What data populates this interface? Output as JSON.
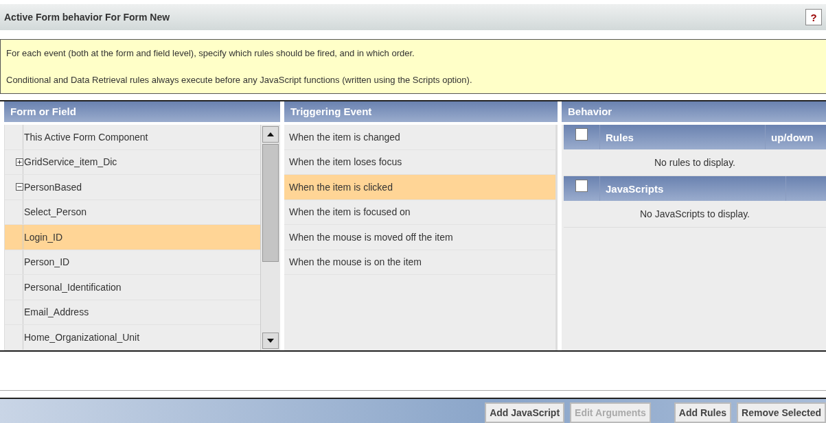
{
  "title": "Active Form behavior For Form New",
  "help": "?",
  "info": [
    "For each event (both at the form and field level), specify which rules should be fired, and in which order.",
    "Conditional and Data Retrieval rules always execute before any JavaScript functions (written using the Scripts option)."
  ],
  "form_or_field": {
    "heading": "Form or Field",
    "items": [
      {
        "label": "This Active Form Component",
        "selected": false
      },
      {
        "label": "GridService_item_Dic",
        "selected": false,
        "expanded": false
      },
      {
        "label": "PersonBased",
        "selected": false,
        "expanded": true,
        "children": [
          {
            "label": "Select_Person",
            "selected": false
          },
          {
            "label": "Login_ID",
            "selected": true
          },
          {
            "label": "Person_ID",
            "selected": false
          },
          {
            "label": "Personal_Identification",
            "selected": false
          },
          {
            "label": "Email_Address",
            "selected": false
          },
          {
            "label": "Home_Organizational_Unit",
            "selected": false
          }
        ]
      }
    ]
  },
  "triggering_event": {
    "heading": "Triggering Event",
    "items": [
      {
        "label": "When the item is changed",
        "selected": false
      },
      {
        "label": "When the item loses focus",
        "selected": false
      },
      {
        "label": "When the item is clicked",
        "selected": true
      },
      {
        "label": "When the item is focused on",
        "selected": false
      },
      {
        "label": "When the mouse is moved off the item",
        "selected": false
      },
      {
        "label": "When the mouse is on the item",
        "selected": false
      }
    ]
  },
  "behavior": {
    "heading": "Behavior",
    "tables": [
      {
        "checked": false,
        "columns": [
          "Rules",
          "up/down"
        ],
        "empty": "No rules to display."
      },
      {
        "checked": false,
        "columns": [
          "JavaScripts"
        ],
        "empty": "No JavaScripts to display."
      }
    ]
  },
  "buttons": [
    {
      "label": "Add JavaScript",
      "disabled": false
    },
    {
      "label": "Edit Arguments",
      "disabled": true
    },
    {
      "label": "Add Rules",
      "disabled": false
    },
    {
      "label": "Remove Selected",
      "disabled": false
    }
  ]
}
